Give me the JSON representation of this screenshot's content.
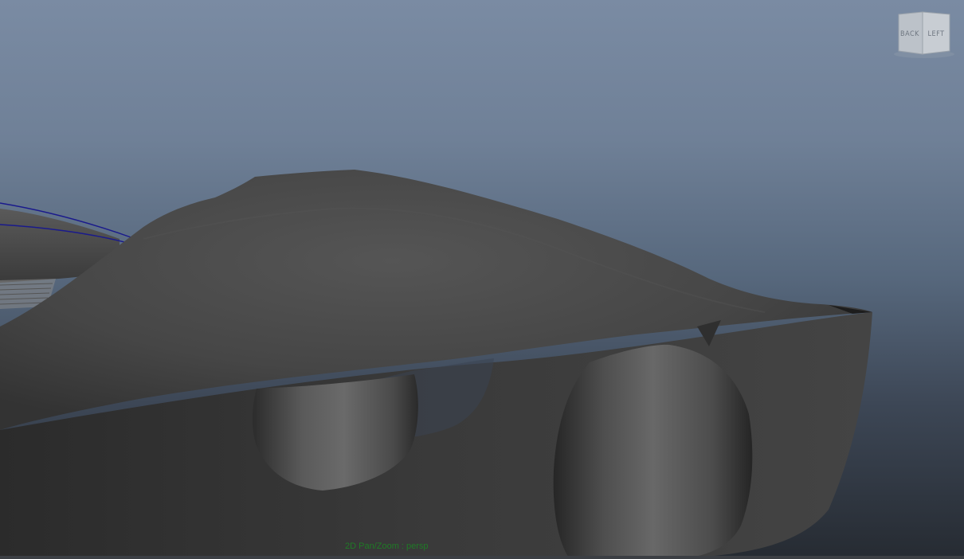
{
  "viewport": {
    "camera": "persp",
    "hud_label": "2D Pan/Zoom : persp"
  },
  "viewcube": {
    "back_label": "BACK",
    "left_label": "LEFT"
  },
  "colors": {
    "background_top": "#7a8ba3",
    "background_bottom": "#262b32",
    "model_gray": "#474747",
    "selection_curve": "#1a1a8c",
    "hud_text": "#1f7a26"
  }
}
